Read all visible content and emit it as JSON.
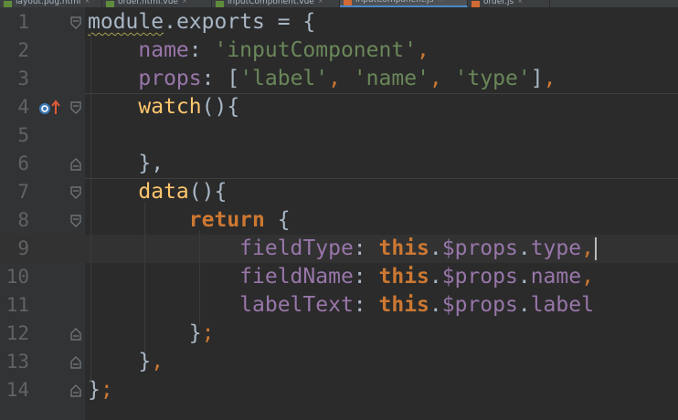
{
  "tabs": [
    {
      "icon": "h",
      "label": "layout.pug.html",
      "active": false
    },
    {
      "icon": "h",
      "label": "order.html.vue",
      "active": false
    },
    {
      "icon": "h",
      "label": "inputComponent.vue",
      "active": false
    },
    {
      "icon": "js",
      "label": "inputComponent.js",
      "active": true
    },
    {
      "icon": "js",
      "label": "order.js",
      "active": false
    }
  ],
  "tab_close_glyph": "×",
  "gutter_marker": "override-method-icon",
  "current_line": 9,
  "colors": {
    "background": "#2b2b2b",
    "gutter": "#313335",
    "keyword": "#cc7832",
    "string": "#6a8759",
    "property": "#9876aa",
    "function": "#ffc66d",
    "plain": "#a9b7c6",
    "line_number": "#606366"
  },
  "lines": [
    {
      "n": "1",
      "tokens": [
        [
          "pl wavy",
          "module"
        ],
        [
          "pl",
          "."
        ],
        [
          "pl",
          "exports"
        ],
        [
          "pl",
          " = {"
        ]
      ]
    },
    {
      "n": "2",
      "tokens": [
        [
          "pl",
          "    "
        ],
        [
          "pr",
          "name"
        ],
        [
          "pl",
          ": "
        ],
        [
          "st",
          "'inputComponent'"
        ],
        [
          "pu",
          ","
        ]
      ]
    },
    {
      "n": "3",
      "tokens": [
        [
          "pl",
          "    "
        ],
        [
          "pr",
          "props"
        ],
        [
          "pl",
          ": ["
        ],
        [
          "st",
          "'label'"
        ],
        [
          "pu",
          ", "
        ],
        [
          "st",
          "'name'"
        ],
        [
          "pu",
          ", "
        ],
        [
          "st",
          "'type'"
        ],
        [
          "pl",
          "]"
        ],
        [
          "pu",
          ","
        ]
      ]
    },
    {
      "n": "4",
      "tokens": [
        [
          "pl",
          "    "
        ],
        [
          "fn",
          "watch"
        ],
        [
          "pl",
          "(){"
        ]
      ]
    },
    {
      "n": "5",
      "tokens": []
    },
    {
      "n": "6",
      "tokens": [
        [
          "pl",
          "    },"
        ]
      ]
    },
    {
      "n": "7",
      "tokens": [
        [
          "pl",
          "    "
        ],
        [
          "fn",
          "data"
        ],
        [
          "pl",
          "(){"
        ]
      ]
    },
    {
      "n": "8",
      "tokens": [
        [
          "pl",
          "        "
        ],
        [
          "kw",
          "return"
        ],
        [
          "pl",
          " {"
        ]
      ]
    },
    {
      "n": "9",
      "tokens": [
        [
          "pl",
          "            "
        ],
        [
          "pr",
          "fieldType"
        ],
        [
          "pl",
          ": "
        ],
        [
          "kw",
          "this"
        ],
        [
          "pl",
          "."
        ],
        [
          "pr",
          "$props"
        ],
        [
          "pl",
          "."
        ],
        [
          "pr",
          "type"
        ],
        [
          "pu",
          ","
        ]
      ]
    },
    {
      "n": "10",
      "tokens": [
        [
          "pl",
          "            "
        ],
        [
          "pr",
          "fieldName"
        ],
        [
          "pl",
          ": "
        ],
        [
          "kw",
          "this"
        ],
        [
          "pl",
          "."
        ],
        [
          "pr",
          "$props"
        ],
        [
          "pl",
          "."
        ],
        [
          "pr",
          "name"
        ],
        [
          "pu",
          ","
        ]
      ]
    },
    {
      "n": "11",
      "tokens": [
        [
          "pl",
          "            "
        ],
        [
          "pr",
          "labelText"
        ],
        [
          "pl",
          ": "
        ],
        [
          "kw",
          "this"
        ],
        [
          "pl",
          "."
        ],
        [
          "pr",
          "$props"
        ],
        [
          "pl",
          "."
        ],
        [
          "pr",
          "label"
        ]
      ]
    },
    {
      "n": "12",
      "tokens": [
        [
          "pl",
          "        }"
        ],
        [
          "pu",
          ";"
        ]
      ]
    },
    {
      "n": "13",
      "tokens": [
        [
          "pl",
          "    }"
        ],
        [
          "pu",
          ","
        ]
      ]
    },
    {
      "n": "14",
      "tokens": [
        [
          "pl",
          "}"
        ],
        [
          "pu",
          ";"
        ]
      ]
    }
  ]
}
